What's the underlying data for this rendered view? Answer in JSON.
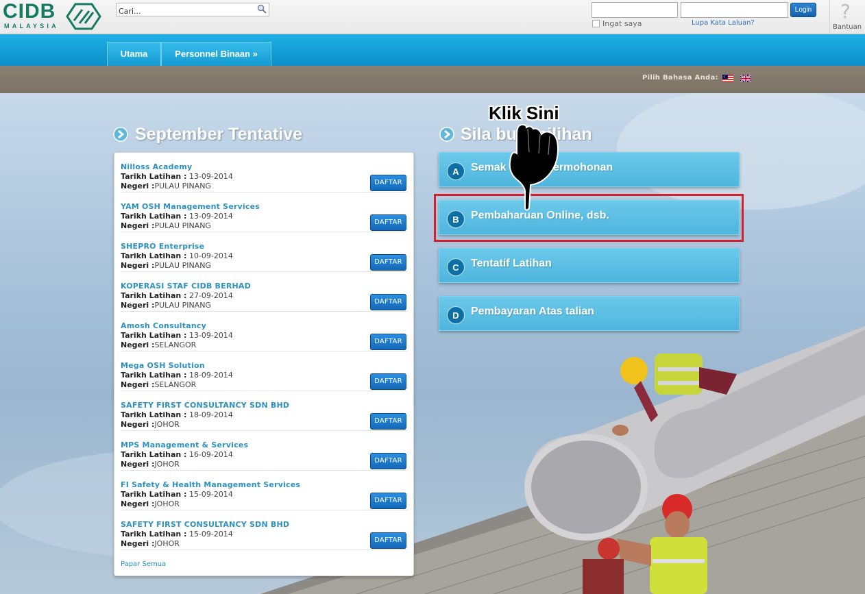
{
  "header": {
    "logo_text": "CIDB",
    "logo_sub": "MALAYSIA",
    "search_placeholder": "Cari...",
    "login_label": "Login",
    "remember_label": "Ingat saya",
    "forgot_label": "Lupa Kata Laluan?",
    "help_label": "Bantuan"
  },
  "nav": {
    "tabs": [
      {
        "label": "Utama"
      },
      {
        "label": "Personnel Binaan »"
      }
    ]
  },
  "language": {
    "label": "Pilih Bahasa Anda:",
    "options": [
      "Bahasa Malaysia",
      "English"
    ]
  },
  "left_section": {
    "title": "September Tentative",
    "date_label": "Tarikh Latihan :",
    "state_label": "Negeri :",
    "button_label": "DAFTAR",
    "view_all": "Papar Semua",
    "entries": [
      {
        "org": "Nilloss Academy",
        "date": "13-09-2014",
        "state": "PULAU PINANG"
      },
      {
        "org": "YAM OSH Management Services",
        "date": "13-09-2014",
        "state": "PULAU PINANG"
      },
      {
        "org": "SHEPRO Enterprise",
        "date": "10-09-2014",
        "state": "PULAU PINANG"
      },
      {
        "org": "KOPERASI STAF CIDB BERHAD",
        "date": "27-09-2014",
        "state": "PULAU PINANG"
      },
      {
        "org": "Amosh Consultancy",
        "date": "13-09-2014",
        "state": "SELANGOR"
      },
      {
        "org": "Mega OSH Solution",
        "date": "18-09-2014",
        "state": "SELANGOR"
      },
      {
        "org": "SAFETY FIRST CONSULTANCY SDN BHD",
        "date": "18-09-2014",
        "state": "JOHOR"
      },
      {
        "org": "MPS Management & Services",
        "date": "16-09-2014",
        "state": "JOHOR"
      },
      {
        "org": "FI Safety & Health Management Services",
        "date": "15-09-2014",
        "state": "JOHOR"
      },
      {
        "org": "SAFETY FIRST CONSULTANCY SDN BHD",
        "date": "15-09-2014",
        "state": "JOHOR"
      }
    ]
  },
  "right_section": {
    "title": "Sila buat pilihan",
    "options": [
      {
        "letter": "A",
        "label": "Semak Status Permohonan"
      },
      {
        "letter": "B",
        "label": "Pembaharuan Online, dsb."
      },
      {
        "letter": "C",
        "label": "Tentatif Latihan"
      },
      {
        "letter": "D",
        "label": "Pembayaran Atas talian"
      }
    ]
  },
  "annotation": {
    "callout": "Klik Sini",
    "highlight_color": "#d3202a"
  },
  "colors": {
    "brand_green": "#167a62",
    "nav_blue": "#1eb0e4",
    "button_blue": "#1468b8",
    "card_blue": "#5ebfe4"
  }
}
